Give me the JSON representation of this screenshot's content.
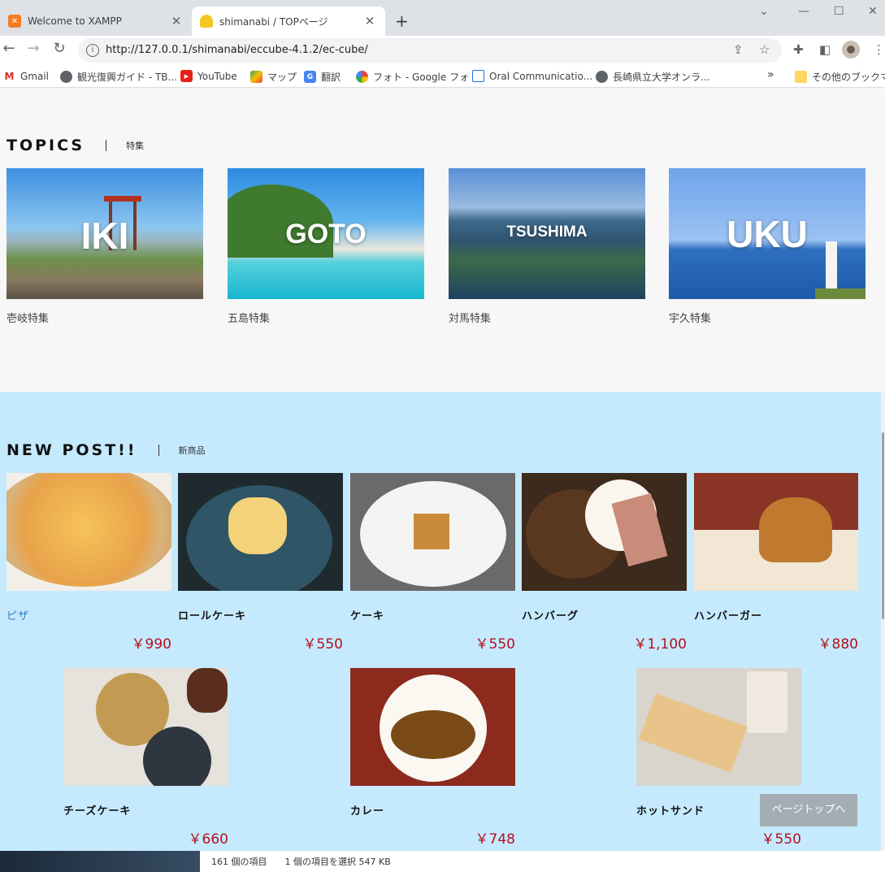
{
  "browser": {
    "tabs": [
      {
        "title": "Welcome to XAMPP",
        "icon": "xampp-icon"
      },
      {
        "title": "shimanabi / TOPページ",
        "icon": "shimanabi-icon"
      }
    ],
    "url": "http://127.0.0.1/shimanabi/eccube-4.1.2/ec-cube/",
    "bookmarks": [
      {
        "label": "Gmail",
        "icon": "gmail-icon"
      },
      {
        "label": "観光復興ガイド - TB...",
        "icon": "globe-icon"
      },
      {
        "label": "YouTube",
        "icon": "youtube-icon"
      },
      {
        "label": "マップ",
        "icon": "maps-icon"
      },
      {
        "label": "翻訳",
        "icon": "translate-icon"
      },
      {
        "label": "フォト - Google フォト",
        "icon": "photos-icon"
      },
      {
        "label": "Oral Communicatio...",
        "icon": "page-icon"
      },
      {
        "label": "長崎県立大学オンラ...",
        "icon": "globe-icon"
      }
    ],
    "bookmarks_overflow": "»",
    "other_bookmarks": "その他のブックマーク"
  },
  "topics": {
    "title": "TOPICS",
    "subtitle": "特集",
    "cards": [
      {
        "banner": "IKI",
        "label": "壱岐特集"
      },
      {
        "banner": "GOTO",
        "label": "五島特集"
      },
      {
        "banner": "TSUSHIMA",
        "label": "対馬特集"
      },
      {
        "banner": "UKU",
        "label": "宇久特集"
      }
    ]
  },
  "newpost": {
    "title": "NEW POST!!",
    "subtitle": "新商品",
    "products": [
      {
        "name": "ピザ",
        "price": "￥990"
      },
      {
        "name": "ロールケーキ",
        "price": "￥550"
      },
      {
        "name": "ケーキ",
        "price": "￥550"
      },
      {
        "name": "ハンバーグ",
        "price": "￥1,100"
      },
      {
        "name": "ハンバーガー",
        "price": "￥880"
      },
      {
        "name": "チーズケーキ",
        "price": "￥660"
      },
      {
        "name": "カレー",
        "price": "￥748"
      },
      {
        "name": "ホットサンド",
        "price": "￥550"
      }
    ]
  },
  "page_top_button": "ページトップへ",
  "explorer_status": {
    "items": "161 個の項目",
    "selected": "1 個の項目を選択  547 KB"
  },
  "colors": {
    "newpost_bg": "#c5eafd",
    "price": "#b5101e",
    "link": "#2a7abf"
  }
}
